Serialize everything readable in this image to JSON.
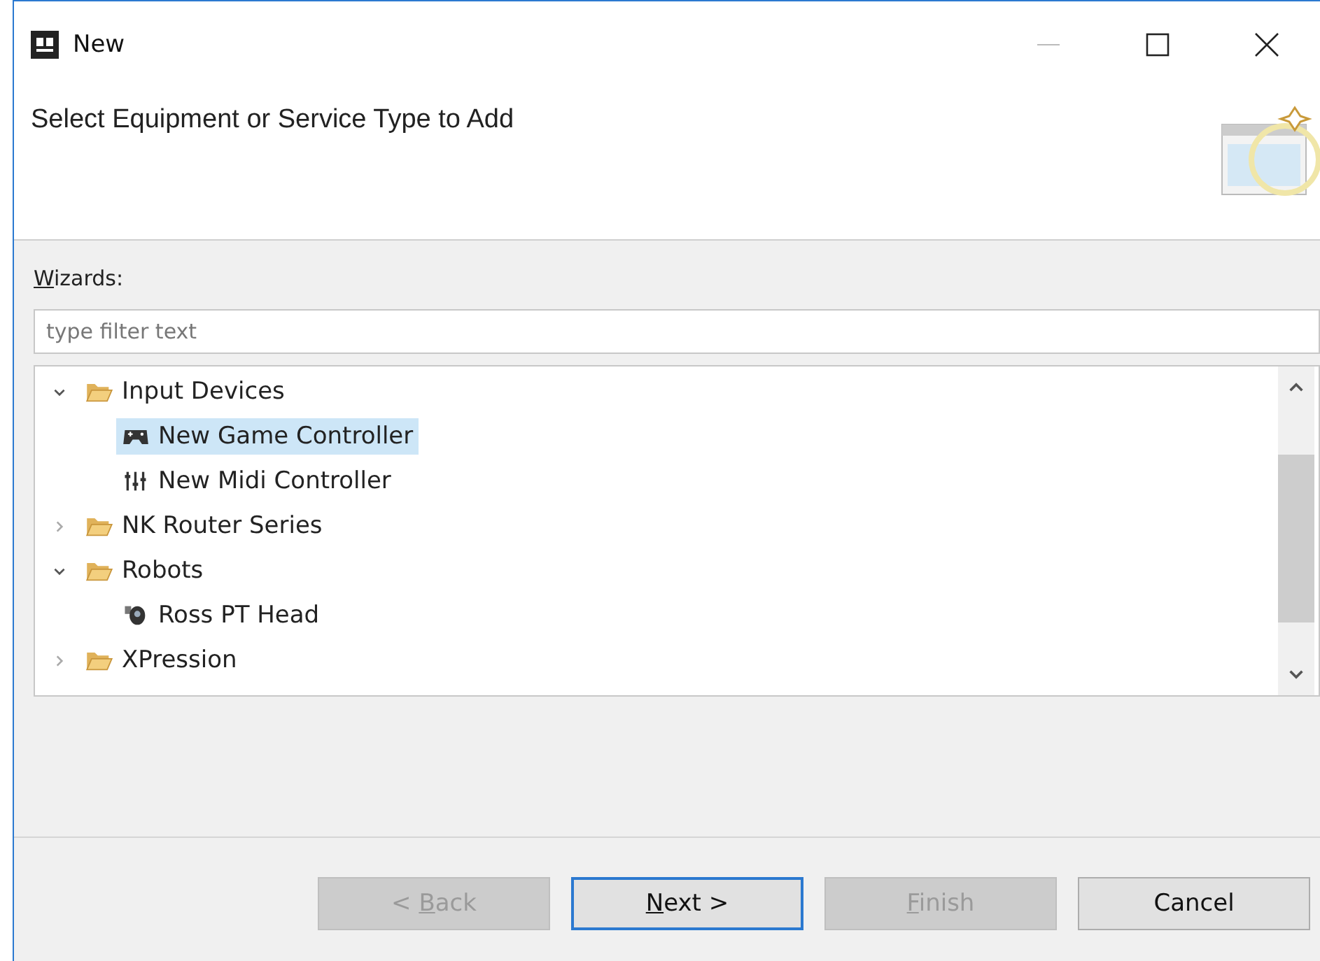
{
  "window": {
    "title": "New"
  },
  "header": {
    "title": "Select Equipment or Service Type to Add"
  },
  "wizards_label": {
    "key": "W",
    "after": "izards:"
  },
  "filter": {
    "placeholder": "type filter text"
  },
  "tree": [
    {
      "label": "Input Devices",
      "kind": "folder",
      "expanded": true,
      "selected": false,
      "children": [
        {
          "label": "New Game Controller",
          "kind": "gamepad",
          "selected": true
        },
        {
          "label": "New Midi Controller",
          "kind": "mixer",
          "selected": false
        }
      ]
    },
    {
      "label": "NK Router Series",
      "kind": "folder",
      "expanded": false,
      "selected": false
    },
    {
      "label": "Robots",
      "kind": "folder",
      "expanded": true,
      "selected": false,
      "children": [
        {
          "label": "Ross PT Head",
          "kind": "camera",
          "selected": false
        }
      ]
    },
    {
      "label": "XPression",
      "kind": "folder",
      "expanded": false,
      "selected": false
    }
  ],
  "buttons": [
    {
      "before": "< ",
      "key": "B",
      "after": "ack",
      "disabled": true,
      "focused": false
    },
    {
      "key": "N",
      "after": "ext >",
      "disabled": false,
      "focused": true
    },
    {
      "key": "F",
      "after": "inish",
      "disabled": true,
      "focused": false
    },
    {
      "before": "Cancel",
      "disabled": false,
      "focused": false
    }
  ]
}
